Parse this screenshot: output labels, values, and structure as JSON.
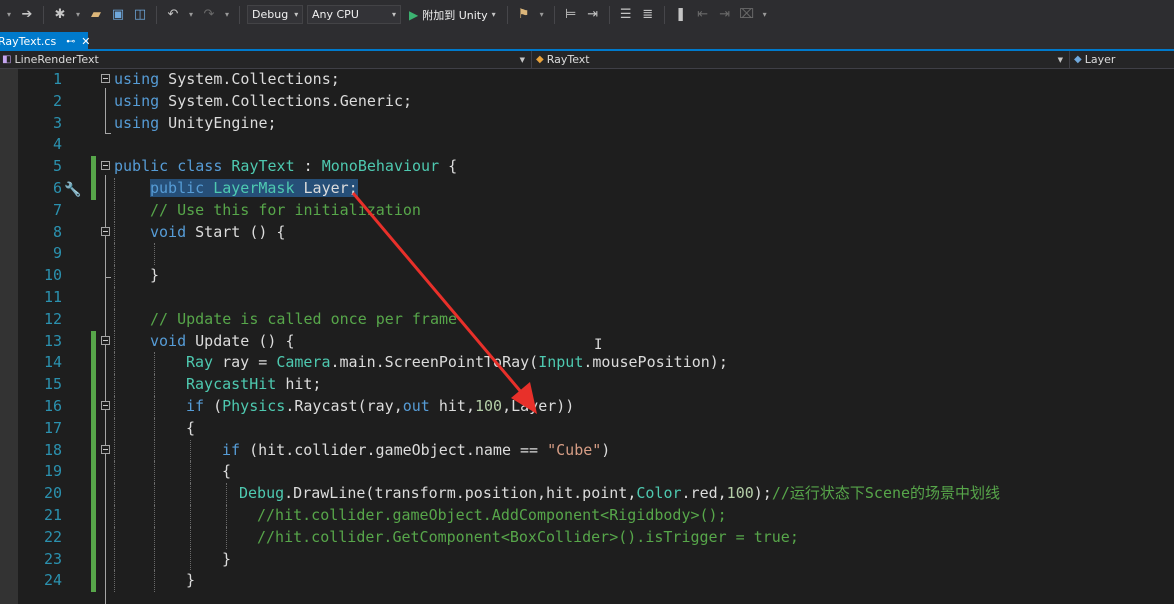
{
  "toolbar": {
    "config_select": "Debug",
    "platform_select": "Any CPU",
    "attach_label": "附加到 Unity"
  },
  "tab": {
    "title": "RayText.cs",
    "pin_glyph": "⊷",
    "close_glyph": "✕"
  },
  "navbar": {
    "project": "LineRenderText",
    "class": "RayText",
    "member": "Layer"
  },
  "icons": {
    "back": "back-arrow-icon",
    "forward": "forward-arrow-icon",
    "new_project": "new-project-icon",
    "open": "open-folder-icon",
    "save": "save-icon",
    "save_all": "save-all-icon",
    "undo": "undo-icon",
    "redo": "redo-icon",
    "play": "play-icon",
    "quick_action": "screwdriver-icon"
  },
  "colors": {
    "keyword": "#569cd6",
    "type": "#4ec9b0",
    "comment": "#57a64a",
    "string": "#d69d85",
    "line_number": "#2b91af",
    "selection": "#264f78",
    "accent": "#007acc",
    "annotation_arrow": "#e8302a"
  },
  "code": {
    "lines": [
      {
        "n": "1"
      },
      {
        "n": "2"
      },
      {
        "n": "3"
      },
      {
        "n": "4"
      },
      {
        "n": "5"
      },
      {
        "n": "6"
      },
      {
        "n": "7"
      },
      {
        "n": "8"
      },
      {
        "n": "9"
      },
      {
        "n": "10"
      },
      {
        "n": "11"
      },
      {
        "n": "12"
      },
      {
        "n": "13"
      },
      {
        "n": "14"
      },
      {
        "n": "15"
      },
      {
        "n": "16"
      },
      {
        "n": "17"
      },
      {
        "n": "18"
      },
      {
        "n": "19"
      },
      {
        "n": "20"
      },
      {
        "n": "21"
      },
      {
        "n": "22"
      },
      {
        "n": "23"
      },
      {
        "n": "24"
      }
    ],
    "t": {
      "using": "using",
      "ns1": " System.Collections;",
      "ns2": " System.Collections.Generic;",
      "ns3": " UnityEngine;",
      "public": "public",
      "class": "class",
      "class_name": "RayText",
      "colon": " : ",
      "base": "MonoBehaviour",
      "open_brace": " {",
      "layermask": "LayerMask",
      "layer_field": " Layer;",
      "c_init": "// Use this for initialization",
      "void": "void",
      "start": " Start () {",
      "close": "}",
      "c_update": "// Update is called once per frame",
      "update": " Update () {",
      "ray": "Ray",
      "ray_eq": " ray = ",
      "camera": "Camera",
      "spr": ".main.ScreenPointToRay(",
      "input": "Input",
      "mousepos": ".mousePosition);",
      "raycasthit": "RaycastHit",
      "hit_decl": " hit;",
      "if": "if",
      "paren": " (",
      "physics": "Physics",
      "raycast_a": ".Raycast(ray,",
      "out": "out",
      "raycast_b": " hit,",
      "n100": "100",
      "raycast_c": ",Layer))",
      "ob": "{",
      "hitname": " (hit.collider.gameObject.name == ",
      "cube": "\"Cube\"",
      "rp": ")",
      "debug": "Debug",
      "drawline": ".DrawLine(transform.position,hit.point,",
      "color": "Color",
      "red": ".red,",
      "end_stmt": ");",
      "c_cn": "//运行状态下Scene的场景中划线",
      "c_add": "//hit.collider.gameObject.AddComponent<Rigidbody>();",
      "c_get": "//hit.collider.GetComponent<BoxCollider>().isTrigger = true;"
    }
  }
}
